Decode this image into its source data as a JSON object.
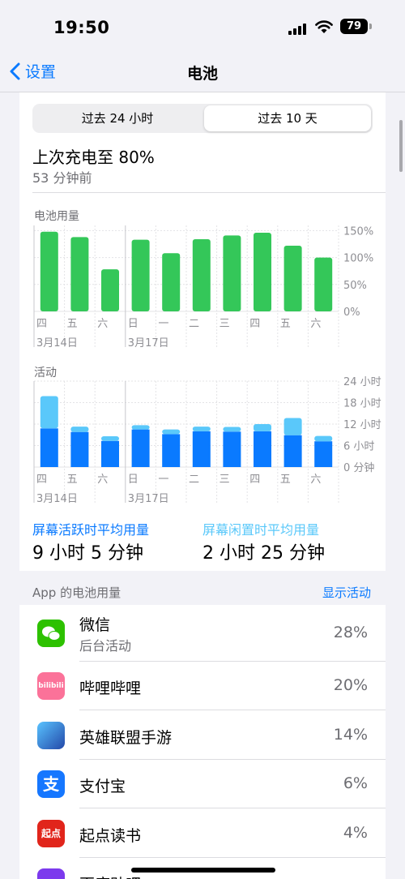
{
  "status": {
    "time": "19:50",
    "battery": "79"
  },
  "nav": {
    "back_label": "设置",
    "title": "电池"
  },
  "segment": {
    "opt1": "过去 24 小时",
    "opt2": "过去 10 天",
    "selected": "过去 10 天"
  },
  "last_charge": {
    "text": "上次充电至 80%",
    "ago": "53 分钟前"
  },
  "colors": {
    "accent": "#0a7aff",
    "battery_green": "#34c759",
    "screen_on": "#0a7aff",
    "screen_off": "#5ac8fa",
    "cyan_label": "#5ac8fa"
  },
  "usage": {
    "screen_on_label": "屏幕活跃时平均用量",
    "screen_on_value": "9 小时 5 分钟",
    "screen_off_label": "屏幕闲置时平均用量",
    "screen_off_value": "2 小时 25 分钟"
  },
  "chart_data": [
    {
      "type": "bar",
      "title": "电池用量",
      "categories": [
        "四",
        "五",
        "六",
        "日",
        "一",
        "二",
        "三",
        "四",
        "五",
        "六"
      ],
      "date_labels": [
        {
          "index": 0,
          "text": "3月14日"
        },
        {
          "index": 3,
          "text": "3月17日"
        }
      ],
      "values": [
        148,
        138,
        78,
        133,
        108,
        134,
        141,
        146,
        122,
        100
      ],
      "unit": "%",
      "yticks": [
        "150%",
        "100%",
        "50%",
        "0%"
      ],
      "ylim": [
        0,
        160
      ]
    },
    {
      "type": "bar",
      "title": "活动",
      "categories": [
        "四",
        "五",
        "六",
        "日",
        "一",
        "二",
        "三",
        "四",
        "五",
        "六"
      ],
      "date_labels": [
        {
          "index": 0,
          "text": "3月14日"
        },
        {
          "index": 3,
          "text": "3月17日"
        }
      ],
      "series": [
        {
          "values": [
            10.8,
            9.8,
            7.3,
            10.5,
            9.2,
            10.0,
            9.9,
            10.0,
            8.9,
            7.2
          ]
        },
        {
          "values": [
            9.0,
            1.5,
            1.3,
            1.2,
            1.3,
            1.3,
            1.3,
            2.0,
            4.8,
            1.5
          ]
        }
      ],
      "stacked": true,
      "unit": "小时",
      "yticks": [
        "24 小时",
        "18 小时",
        "12 小时",
        "6 小时",
        "0 分钟"
      ],
      "ylim": [
        0,
        24
      ]
    }
  ],
  "apps": {
    "header": "App 的电池用量",
    "toggle": "显示活动",
    "items": [
      {
        "name": "微信",
        "sub": "后台活动",
        "pct": "28%",
        "icon": "wechat-icon",
        "color": "#2dc100",
        "glyph": ""
      },
      {
        "name": "哔哩哔哩",
        "sub": "",
        "pct": "20%",
        "icon": "bilibili-icon",
        "color": "#fb7299",
        "glyph": "bilibili"
      },
      {
        "name": "英雄联盟手游",
        "sub": "",
        "pct": "14%",
        "icon": "league-of-legends-icon",
        "color": "#2a5fd0",
        "glyph": ""
      },
      {
        "name": "支付宝",
        "sub": "",
        "pct": "6%",
        "icon": "alipay-icon",
        "color": "#1677ff",
        "glyph": "支"
      },
      {
        "name": "起点读书",
        "sub": "",
        "pct": "4%",
        "icon": "qidian-icon",
        "color": "#e1251b",
        "glyph": "起点"
      },
      {
        "name": "百度贴吧",
        "sub": "",
        "pct": "",
        "icon": "tieba-icon",
        "color": "#7c3aed",
        "glyph": ""
      }
    ]
  }
}
